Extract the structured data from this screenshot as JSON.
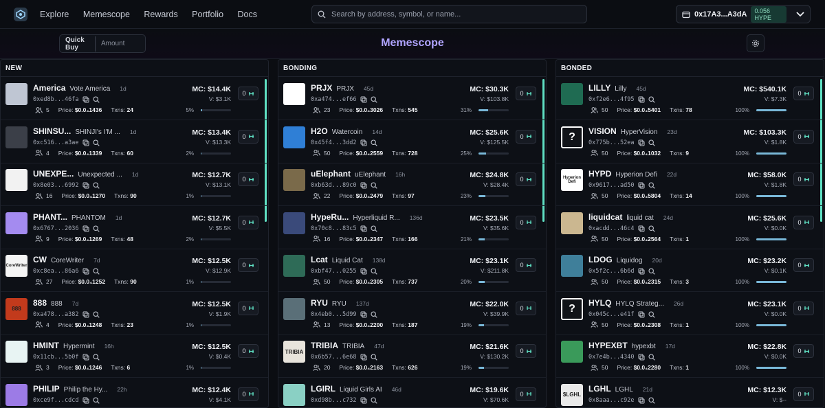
{
  "nav": {
    "items": [
      "Explore",
      "Memescope",
      "Rewards",
      "Portfolio",
      "Docs"
    ]
  },
  "search": {
    "placeholder": "Search by address, symbol, or name..."
  },
  "wallet": {
    "address": "0x17A3...A3dA",
    "balance": "0.056 HYPE"
  },
  "quick_buy": {
    "label": "Quick Buy",
    "placeholder": "Amount"
  },
  "page": {
    "title": "Memescope"
  },
  "colors": {
    "accent": "#b0a4ff",
    "progress": "#79b8d8",
    "scrollbar": "#5fe0c3"
  },
  "columns": [
    {
      "title": "NEW",
      "tokens": [
        {
          "symbol": "America",
          "name": "Vote America",
          "age": "1d",
          "ca": "0xed8b...46fa",
          "holders": "5",
          "price": "$0.0₄1436",
          "txns": "24",
          "mc": "MC: $14.4K",
          "vol": "V: $3.1K",
          "progress": 5,
          "progress_label": "5%",
          "buy": "0",
          "img_bg": "#bfc6d3",
          "img_text": ""
        },
        {
          "symbol": "SHINSU...",
          "name": "SHINJI's I'M ...",
          "age": "1d",
          "ca": "0xc516...a3ae",
          "holders": "4",
          "price": "$0.0₄1339",
          "txns": "60",
          "mc": "MC: $13.4K",
          "vol": "V: $13.3K",
          "progress": 2,
          "progress_label": "2%",
          "buy": "0",
          "img_bg": "#3b3f48",
          "img_text": ""
        },
        {
          "symbol": "UNEXPE...",
          "name": "Unexpected ...",
          "age": "1d",
          "ca": "0x8e03...6992",
          "holders": "16",
          "price": "$0.0₄1270",
          "txns": "90",
          "mc": "MC: $12.7K",
          "vol": "V: $13.1K",
          "progress": 1,
          "progress_label": "1%",
          "buy": "0",
          "img_bg": "#f2f2f2",
          "img_text": ""
        },
        {
          "symbol": "PHANT...",
          "name": "PHANTOM",
          "age": "1d",
          "ca": "0x6767...2036",
          "holders": "9",
          "price": "$0.0₄1269",
          "txns": "48",
          "mc": "MC: $12.7K",
          "vol": "V: $5.5K",
          "progress": 2,
          "progress_label": "2%",
          "buy": "0",
          "img_bg": "#a48bf0",
          "img_text": ""
        },
        {
          "symbol": "CW",
          "name": "CoreWriter",
          "age": "7d",
          "ca": "0xc8ea...86a6",
          "holders": "27",
          "price": "$0.0₄1252",
          "txns": "90",
          "mc": "MC: $12.5K",
          "vol": "V: $12.9K",
          "progress": 1,
          "progress_label": "1%",
          "buy": "0",
          "img_bg": "#f4f4f4",
          "img_text": "CoreWriter"
        },
        {
          "symbol": "888",
          "name": "888",
          "age": "7d",
          "ca": "0xa478...a382",
          "holders": "4",
          "price": "$0.0₄1248",
          "txns": "23",
          "mc": "MC: $12.5K",
          "vol": "V: $1.9K",
          "progress": 1,
          "progress_label": "1%",
          "buy": "0",
          "img_bg": "#c23a1c",
          "img_text": "888"
        },
        {
          "symbol": "HMINT",
          "name": "Hypermint",
          "age": "16h",
          "ca": "0x11cb...5b0f",
          "holders": "3",
          "price": "$0.0₄1246",
          "txns": "6",
          "mc": "MC: $12.5K",
          "vol": "V: $0.4K",
          "progress": 1,
          "progress_label": "1%",
          "buy": "0",
          "img_bg": "#e8f4f3",
          "img_text": ""
        },
        {
          "symbol": "PHILIP",
          "name": "Philip the Hy...",
          "age": "22h",
          "ca": "0xce9f...cdcd",
          "holders": "",
          "price": "",
          "txns": "",
          "mc": "MC: $12.4K",
          "vol": "V: $4.1K",
          "progress": 0,
          "progress_label": "",
          "buy": "0",
          "img_bg": "#9c7be6",
          "img_text": ""
        }
      ]
    },
    {
      "title": "BONDING",
      "tokens": [
        {
          "symbol": "PRJX",
          "name": "PRJX",
          "age": "45d",
          "ca": "0xa474...ef66",
          "holders": "23",
          "price": "$0.0₄3026",
          "txns": "545",
          "mc": "MC: $30.3K",
          "vol": "V: $103.8K",
          "progress": 31,
          "progress_label": "31%",
          "buy": "0",
          "img_bg": "#ffffff",
          "img_text": ""
        },
        {
          "symbol": "H2O",
          "name": "Watercoin",
          "age": "14d",
          "ca": "0x45f4...3dd2",
          "holders": "50",
          "price": "$0.0₄2559",
          "txns": "728",
          "mc": "MC: $25.6K",
          "vol": "V: $125.5K",
          "progress": 25,
          "progress_label": "25%",
          "buy": "0",
          "img_bg": "#2f7fd6",
          "img_text": ""
        },
        {
          "symbol": "uElephant",
          "name": "uElephant",
          "age": "16h",
          "ca": "0xb63d...89c0",
          "holders": "22",
          "price": "$0.0₄2479",
          "txns": "97",
          "mc": "MC: $24.8K",
          "vol": "V: $28.4K",
          "progress": 23,
          "progress_label": "23%",
          "buy": "0",
          "img_bg": "#7a6a4a",
          "img_text": ""
        },
        {
          "symbol": "HypeRu...",
          "name": "Hyperliquid R...",
          "age": "136d",
          "ca": "0x70c8...83c5",
          "holders": "16",
          "price": "$0.0₄2347",
          "txns": "166",
          "mc": "MC: $23.5K",
          "vol": "V: $35.6K",
          "progress": 21,
          "progress_label": "21%",
          "buy": "0",
          "img_bg": "#3a4a7a",
          "img_text": ""
        },
        {
          "symbol": "Lcat",
          "name": "Liquid Cat",
          "age": "138d",
          "ca": "0xbf47...0255",
          "holders": "50",
          "price": "$0.0₄2305",
          "txns": "737",
          "mc": "MC: $23.1K",
          "vol": "V: $211.8K",
          "progress": 20,
          "progress_label": "20%",
          "buy": "0",
          "img_bg": "#2e6b57",
          "img_text": ""
        },
        {
          "symbol": "RYU",
          "name": "RYU",
          "age": "137d",
          "ca": "0x4eb0...5d99",
          "holders": "13",
          "price": "$0.0₄2200",
          "txns": "187",
          "mc": "MC: $22.0K",
          "vol": "V: $39.9K",
          "progress": 19,
          "progress_label": "19%",
          "buy": "0",
          "img_bg": "#5a6f78",
          "img_text": ""
        },
        {
          "symbol": "TRIBIA",
          "name": "TRIBIA",
          "age": "47d",
          "ca": "0x6b57...6e68",
          "holders": "20",
          "price": "$0.0₄2163",
          "txns": "626",
          "mc": "MC: $21.6K",
          "vol": "V: $130.2K",
          "progress": 19,
          "progress_label": "19%",
          "buy": "0",
          "img_bg": "#e8e4dc",
          "img_text": "TRIBIA"
        },
        {
          "symbol": "LGIRL",
          "name": "Liquid Girls AI",
          "age": "46d",
          "ca": "0xd98b...c732",
          "holders": "",
          "price": "",
          "txns": "",
          "mc": "MC: $19.6K",
          "vol": "V: $70.6K",
          "progress": 0,
          "progress_label": "",
          "buy": "0",
          "img_bg": "#8ad0c4",
          "img_text": ""
        }
      ]
    },
    {
      "title": "BONDED",
      "tokens": [
        {
          "symbol": "LILLY",
          "name": "Lilly",
          "age": "45d",
          "ca": "0xf2e6...4f95",
          "holders": "50",
          "price": "$0.0₄5401",
          "txns": "78",
          "mc": "MC: $540.1K",
          "vol": "V: $7.3K",
          "progress": 100,
          "progress_label": "100%",
          "buy": "0",
          "img_bg": "#1f6b52",
          "img_text": ""
        },
        {
          "symbol": "VISION",
          "name": "HyperVision",
          "age": "23d",
          "ca": "0x775b...52ea",
          "holders": "50",
          "price": "$0.0₄1032",
          "txns": "9",
          "mc": "MC: $103.3K",
          "vol": "V: $1.8K",
          "progress": 100,
          "progress_label": "100%",
          "buy": "0",
          "img_bg": "#111318",
          "img_text": "?"
        },
        {
          "symbol": "HYPD",
          "name": "Hyperion Defi",
          "age": "22d",
          "ca": "0x9617...ad50",
          "holders": "50",
          "price": "$0.0₄5804",
          "txns": "14",
          "mc": "MC: $58.0K",
          "vol": "V: $1.8K",
          "progress": 100,
          "progress_label": "100%",
          "buy": "0",
          "img_bg": "#ffffff",
          "img_text": "Hyperion Defi"
        },
        {
          "symbol": "liquidcat",
          "name": "liquid cat",
          "age": "24d",
          "ca": "0xacdd...46c4",
          "holders": "50",
          "price": "$0.0₄2564",
          "txns": "1",
          "mc": "MC: $25.6K",
          "vol": "V: $0.0K",
          "progress": 100,
          "progress_label": "100%",
          "buy": "0",
          "img_bg": "#cbb790",
          "img_text": ""
        },
        {
          "symbol": "LDOG",
          "name": "Liquidog",
          "age": "20d",
          "ca": "0x5f2c...6b6d",
          "holders": "50",
          "price": "$0.0₄2315",
          "txns": "3",
          "mc": "MC: $23.2K",
          "vol": "V: $0.1K",
          "progress": 100,
          "progress_label": "100%",
          "buy": "0",
          "img_bg": "#3f7f9a",
          "img_text": ""
        },
        {
          "symbol": "HYLQ",
          "name": "HYLQ Strateg...",
          "age": "26d",
          "ca": "0x045c...e41f",
          "holders": "50",
          "price": "$0.0₄2308",
          "txns": "1",
          "mc": "MC: $23.1K",
          "vol": "V: $0.0K",
          "progress": 100,
          "progress_label": "100%",
          "buy": "0",
          "img_bg": "#111318",
          "img_text": "?"
        },
        {
          "symbol": "HYPEXBT",
          "name": "hypexbt",
          "age": "17d",
          "ca": "0x7e4b...4340",
          "holders": "50",
          "price": "$0.0₄2280",
          "txns": "1",
          "mc": "MC: $22.8K",
          "vol": "V: $0.0K",
          "progress": 100,
          "progress_label": "100%",
          "buy": "0",
          "img_bg": "#3a9a5a",
          "img_text": ""
        },
        {
          "symbol": "LGHL",
          "name": "LGHL",
          "age": "21d",
          "ca": "0x8aaa...c92e",
          "holders": "",
          "price": "",
          "txns": "",
          "mc": "MC: $12.3K",
          "vol": "V: $--",
          "progress": 0,
          "progress_label": "",
          "buy": "0",
          "img_bg": "#e9e9e9",
          "img_text": "$LGHL"
        }
      ]
    }
  ]
}
